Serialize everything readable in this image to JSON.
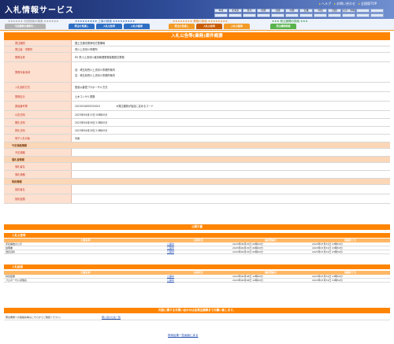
{
  "app": {
    "title": "入札情報サービス",
    "top_links": [
      "ヘルプ",
      "お問い合わせ",
      "全国版TOP"
    ],
    "regions": [
      "本省",
      "北海道",
      "東北",
      "関東",
      "北陸",
      "中部",
      "近畿",
      "中国",
      "四国",
      "九州・沖縄",
      "",
      "",
      "",
      "",
      "",
      "",
      "",
      "",
      "",
      "",
      "",
      "",
      "",
      "",
      "",
      ""
    ]
  },
  "nav": {
    "groups": [
      "★★★★★★ 今回検索の検索 ★★★★★★",
      "★★★★★★★★★ 工事の検索 ★★★★★★★★★",
      "★★★★★★★★ 業務の検索 ★★★★★★★★",
      "★★★ 発注機関の検索 ★★★"
    ],
    "tabs_group1": [
      "今回検索の検索を…"
    ],
    "tabs_group2": [
      "発注の見通し",
      "入札公告等",
      "入札の結果"
    ],
    "tabs_group3": [
      "発注の見通し",
      "入札公告等",
      "入札の結果"
    ],
    "tabs_group4": [
      "発注機関情報"
    ]
  },
  "detail": {
    "title": "入札公告等(業務)案件概要",
    "rows": [
      {
        "label": "発注機関",
        "value": "国土交通省関東地方整備局"
      },
      {
        "label": "発注者・事務所",
        "value": "荒川上流河川事務所"
      },
      {
        "label": "業務名称",
        "value": "R5 荒川上流河川維持管理業務保険検討業務"
      },
      {
        "label": "業務対象地域",
        "value": "自：埼玉県荒川上流河川事務所管内",
        "value2": "至：埼玉県荒川上流河川事務所管内"
      },
      {
        "label": "入札契約方式",
        "value": "簡易公募型プロポーザル方式"
      },
      {
        "label": "業務区分",
        "value": "土木コンサル業務"
      },
      {
        "label": "調達番号等",
        "value": "2023034659320001",
        "note": "※発注機関が独自に定めるコード"
      },
      {
        "label": "公告日時",
        "value": "2023年06月15日 00時00分"
      },
      {
        "label": "開札日時",
        "value": "2023年06月06日 15時00分"
      },
      {
        "label": "掲札日時",
        "value": "2023年06月28日 10時00分"
      },
      {
        "label": "電子入札対象",
        "value": "対象"
      }
    ],
    "sections": [
      {
        "heading": "予定価格情報",
        "rows": [
          {
            "label": "予定価格",
            "value": ""
          }
        ]
      },
      {
        "heading": "落札者情報",
        "rows": [
          {
            "label": "落札者名",
            "value": ""
          },
          {
            "label": "落札価格",
            "value": ""
          }
        ]
      },
      {
        "heading": "契約情報",
        "rows": [
          {
            "label": "契約者名",
            "value": ""
          },
          {
            "label": "契約金額",
            "value": ""
          }
        ]
      }
    ]
  },
  "documents": {
    "title": "公開文書",
    "columns": [
      "文書名称",
      "公開状況",
      "最終登録日",
      "掲載終了日"
    ],
    "announce": {
      "heading": "入札公告等",
      "rows": [
        {
          "name": "手続開始の公示",
          "status": "公開中",
          "registered": "2023年06月15日 00時00分",
          "ends": "2023年07月31日 23時59分"
        },
        {
          "name": "説明書",
          "status": "公開中",
          "registered": "2023年06月15日 00時00分",
          "ends": "2023年07月31日 23時59分"
        },
        {
          "name": "選定資料",
          "status": "公開中",
          "registered": "2023年06月15日 00時00分",
          "ends": "2023年07月31日 23時59分"
        }
      ]
    },
    "results": {
      "heading": "入札経過",
      "rows": [
        {
          "name": "特定結果",
          "status": "公開中",
          "registered": "2023年06月28日 12時00分",
          "ends": "2023年07月31日 23時59分"
        },
        {
          "name": "プロポーザル評価表",
          "status": "公開中",
          "registered": "2023年06月28日 12時00分",
          "ends": "2023年07月31日 23時59分"
        }
      ]
    }
  },
  "inquiry": {
    "title": "内容に関するお問い合わせは各発注機関までお願い致します。",
    "text": "発注機関への連絡先等はこちらからご確認ください。",
    "link": "問い合わせ先一覧"
  },
  "back_link": "検索結果一覧画面に戻る"
}
